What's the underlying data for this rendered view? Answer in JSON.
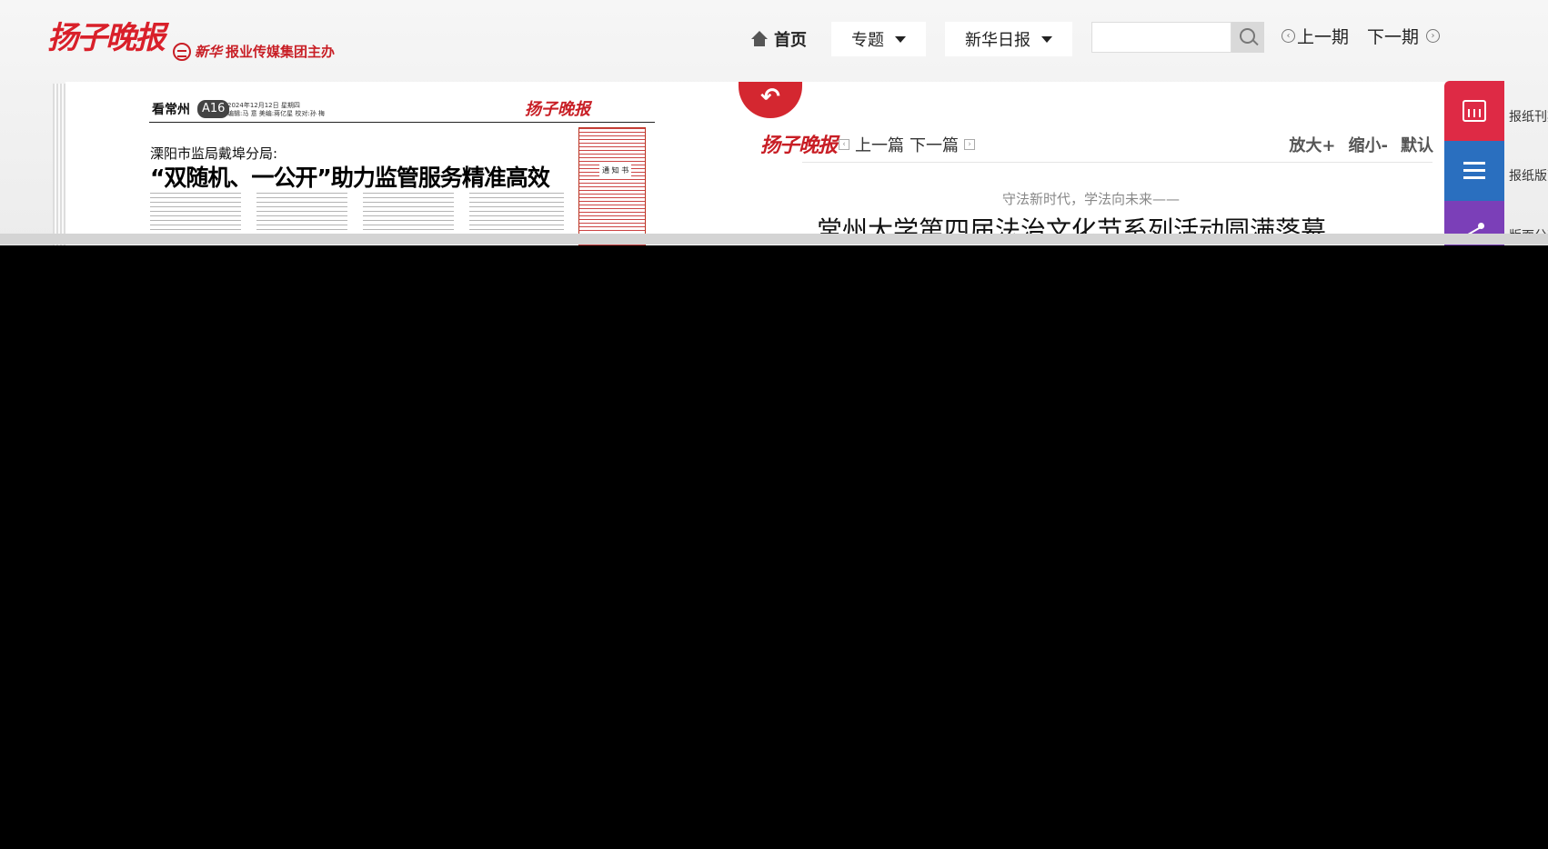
{
  "header": {
    "logo": "扬子晚报",
    "sponsor": "报业传媒集团主办",
    "sponsor_mark": "新华"
  },
  "nav": {
    "home": "首页",
    "topics": "专题",
    "xinhua": "新华日报",
    "search_value": "",
    "prev_issue": "上一期",
    "next_issue": "下一期"
  },
  "page": {
    "section": "看常州",
    "page_no": "A16",
    "date_line": "2024年12月12日 星期四",
    "editors": "编辑:马 意  美编:蒋亿星  校对:孙 梅",
    "logo": "扬子晚报",
    "subtitle": "溧阳市监局戴埠分局:",
    "headline": "“双随机、一公开”助力监管服务精准高效",
    "notice": "通 知 书"
  },
  "article": {
    "logo": "扬子晚报",
    "prev": "上一篇",
    "next": "下一篇",
    "zoom_in": "放大+",
    "zoom_out": "缩小-",
    "default": "默认",
    "kicker": "守法新时代，学法向未来——",
    "title": "常州大学第四届法治文化节系列活动圆满落幕"
  },
  "sidebar": {
    "items": [
      {
        "label": "报纸刊期"
      },
      {
        "label": "报纸版面"
      },
      {
        "label": "版面分享"
      }
    ]
  },
  "colors": {
    "brand_red": "#d42730",
    "side_red": "#de2a45",
    "side_blue": "#2a6fbf",
    "side_purple": "#7b3fb8"
  }
}
